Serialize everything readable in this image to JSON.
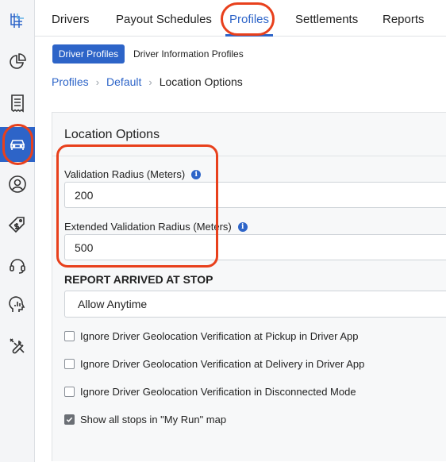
{
  "sidebar": {
    "items": [
      {
        "icon": "logo-icon"
      },
      {
        "icon": "pie-chart-icon"
      },
      {
        "icon": "receipt-icon"
      },
      {
        "icon": "car-icon",
        "active": true
      },
      {
        "icon": "user-icon"
      },
      {
        "icon": "price-tag-icon"
      },
      {
        "icon": "headset-icon"
      },
      {
        "icon": "analytics-head-icon"
      },
      {
        "icon": "tools-icon"
      }
    ]
  },
  "tabs": {
    "drivers": "Drivers",
    "payout_schedules": "Payout Schedules",
    "profiles": "Profiles",
    "settlements": "Settlements",
    "reports": "Reports"
  },
  "subtabs": {
    "driver_profiles": "Driver Profiles",
    "driver_information_profiles": "Driver Information Profiles"
  },
  "breadcrumb": {
    "profiles": "Profiles",
    "default": "Default",
    "current": "Location Options",
    "separator": "›"
  },
  "panel": {
    "title": "Location Options",
    "validation_radius_label": "Validation Radius (Meters)",
    "validation_radius_value": "200",
    "extended_radius_label": "Extended Validation Radius (Meters)",
    "extended_radius_value": "500",
    "report_arrived_heading": "REPORT ARRIVED AT STOP",
    "report_arrived_value": "Allow Anytime",
    "checkboxes": [
      {
        "label": "Ignore Driver Geolocation Verification at Pickup in Driver App",
        "checked": false
      },
      {
        "label": "Ignore Driver Geolocation Verification at Delivery in Driver App",
        "checked": false
      },
      {
        "label": "Ignore Driver Geolocation Verification in Disconnected Mode",
        "checked": false
      },
      {
        "label": "Show all stops in \"My Run\" map",
        "checked": true
      }
    ]
  },
  "colors": {
    "accent": "#2d64c8",
    "highlight": "#e8401c"
  }
}
